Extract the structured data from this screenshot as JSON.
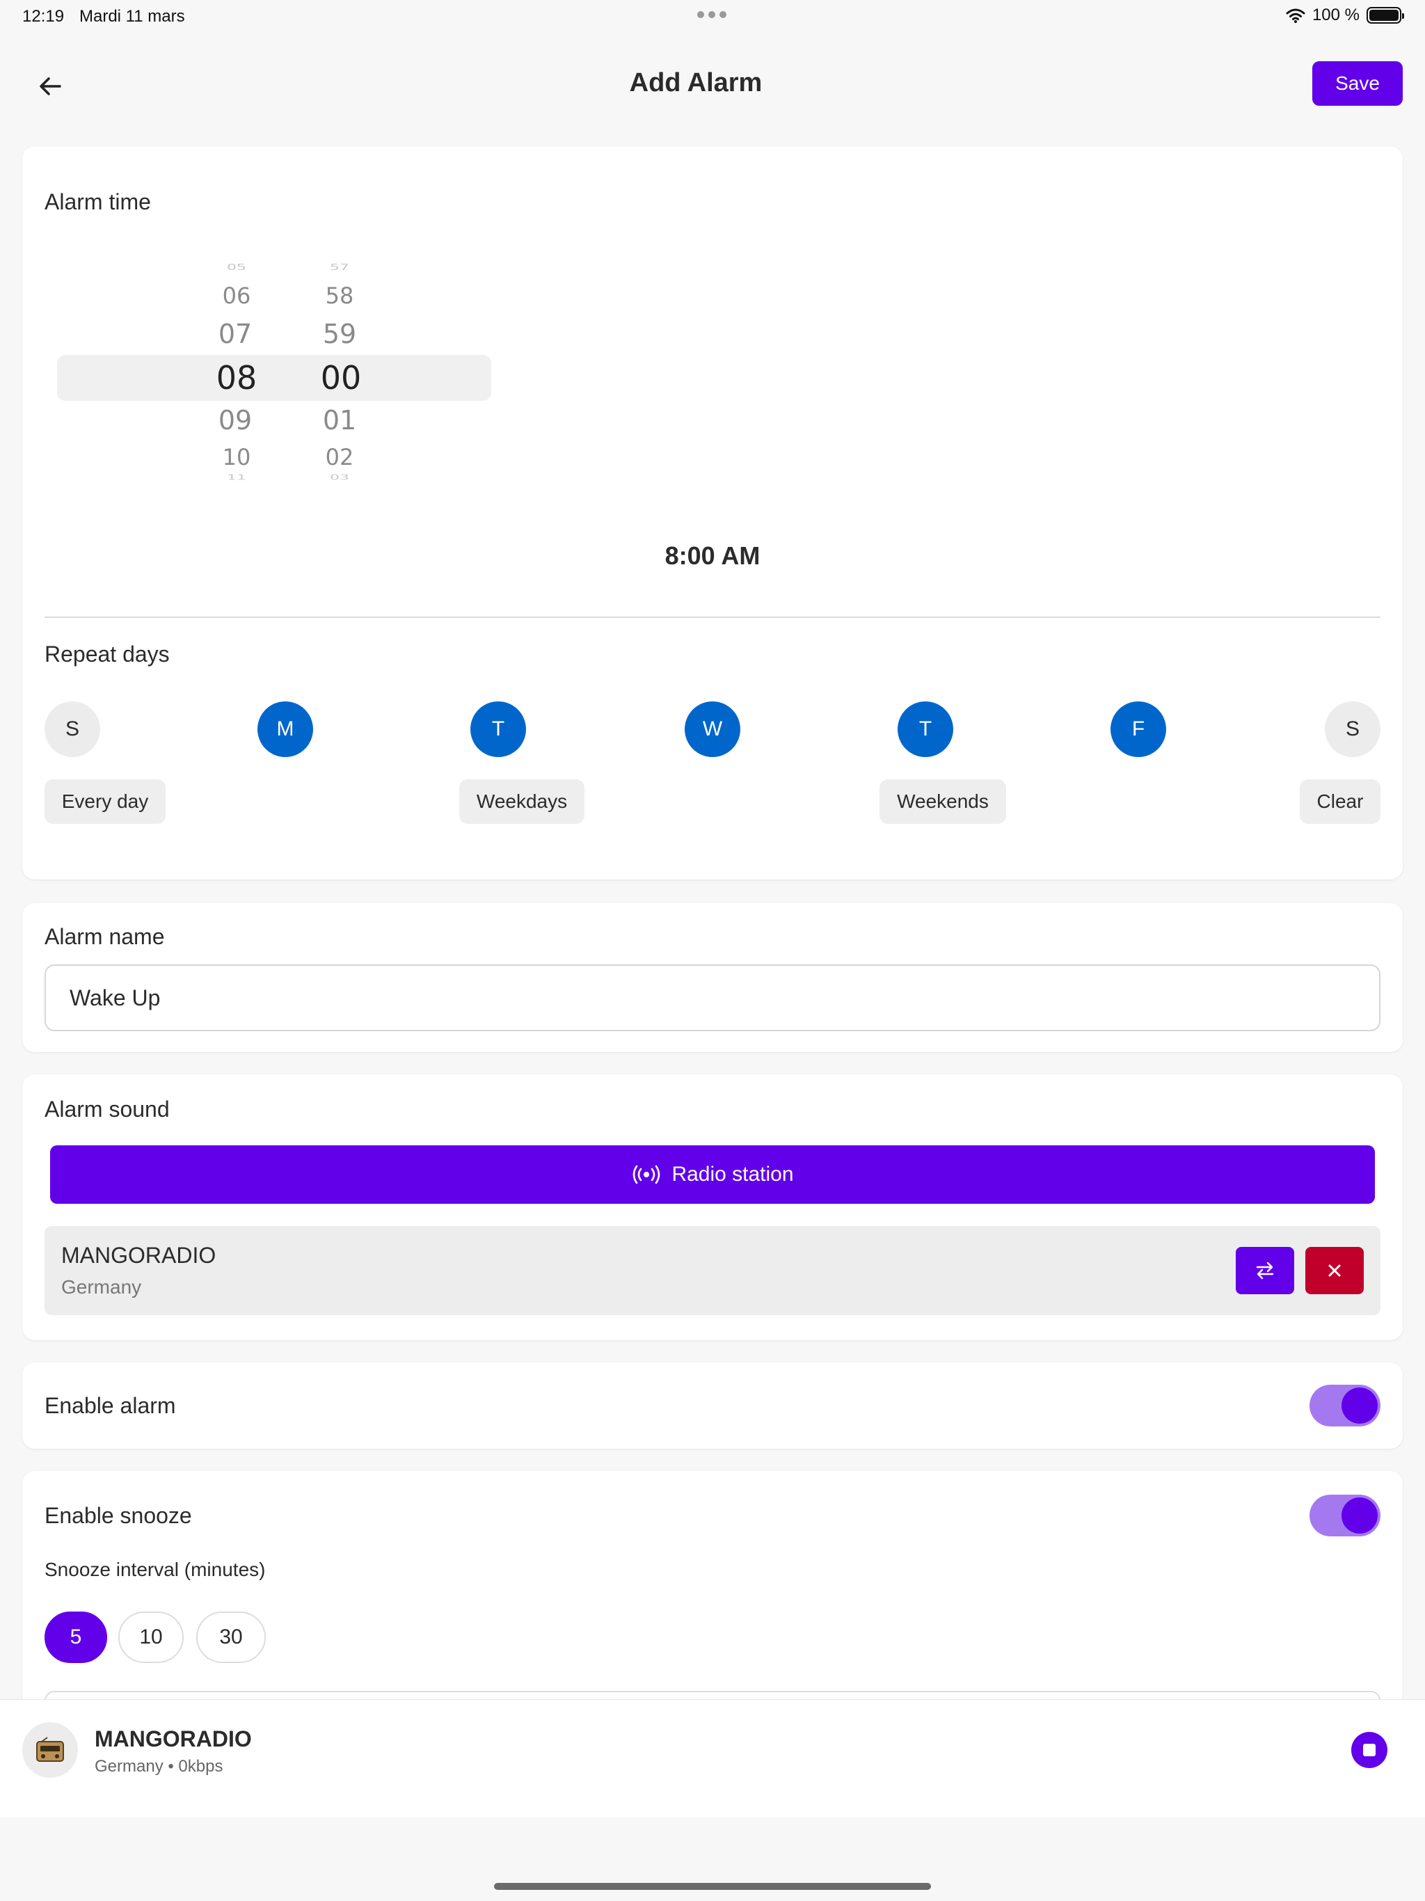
{
  "status_bar": {
    "time": "12:19",
    "date": "Mardi 11 mars",
    "battery": "100 %"
  },
  "header": {
    "title": "Add Alarm",
    "save_label": "Save"
  },
  "alarm_time": {
    "label": "Alarm time",
    "hours": [
      "05",
      "06",
      "07",
      "08",
      "09",
      "10",
      "11"
    ],
    "minutes": [
      "57",
      "58",
      "59",
      "00",
      "01",
      "02",
      "03"
    ],
    "selected_hour": "08",
    "selected_minute": "00",
    "display": "8:00 AM"
  },
  "repeat_days": {
    "label": "Repeat days",
    "days": [
      {
        "letter": "S",
        "selected": false
      },
      {
        "letter": "M",
        "selected": true
      },
      {
        "letter": "T",
        "selected": true
      },
      {
        "letter": "W",
        "selected": true
      },
      {
        "letter": "T",
        "selected": true
      },
      {
        "letter": "F",
        "selected": true
      },
      {
        "letter": "S",
        "selected": false
      }
    ],
    "presets": [
      "Every day",
      "Weekdays",
      "Weekends",
      "Clear"
    ]
  },
  "alarm_name": {
    "label": "Alarm name",
    "value": "Wake Up"
  },
  "alarm_sound": {
    "label": "Alarm sound",
    "radio_button_label": "Radio station",
    "station_name": "MANGORADIO",
    "station_country": "Germany"
  },
  "enable_alarm": {
    "label": "Enable alarm",
    "on": true
  },
  "snooze": {
    "label": "Enable snooze",
    "on": true,
    "interval_label": "Snooze interval (minutes)",
    "options": [
      "5",
      "10",
      "30"
    ],
    "selected": "5"
  },
  "player": {
    "title": "MANGORADIO",
    "subtitle": "Germany • 0kbps"
  },
  "colors": {
    "accent": "#6200ea",
    "day_selected": "#0066cc",
    "danger": "#c0002a",
    "toggle_track": "#a479f0"
  }
}
